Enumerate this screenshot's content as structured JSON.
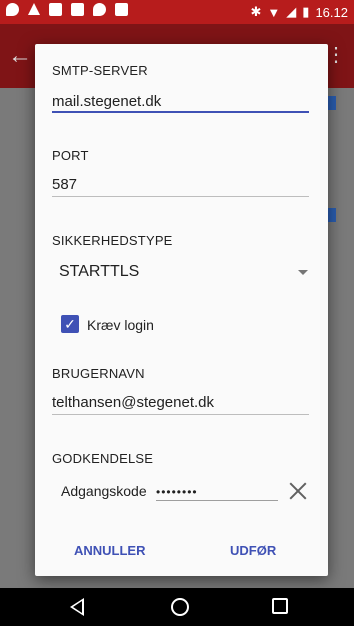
{
  "statusbar": {
    "time": "16.12"
  },
  "dialog": {
    "smtp_label": "SMTP-SERVER",
    "smtp_value": "mail.stegenet.dk",
    "port_label": "PORT",
    "port_value": "587",
    "security_label": "SIKKERHEDSTYPE",
    "security_value": "STARTTLS",
    "login_label": "Kræv login",
    "login_checked": true,
    "username_label": "BRUGERNAVN",
    "username_value": "telthansen@stegenet.dk",
    "auth_label": "GODKENDELSE",
    "password_label": "Adgangskode",
    "password_value": "••••••••",
    "cancel_label": "ANNULLER",
    "done_label": "UDFØR"
  },
  "colors": {
    "accent": "#3f51b5",
    "statusbar": "#b71c1c"
  }
}
